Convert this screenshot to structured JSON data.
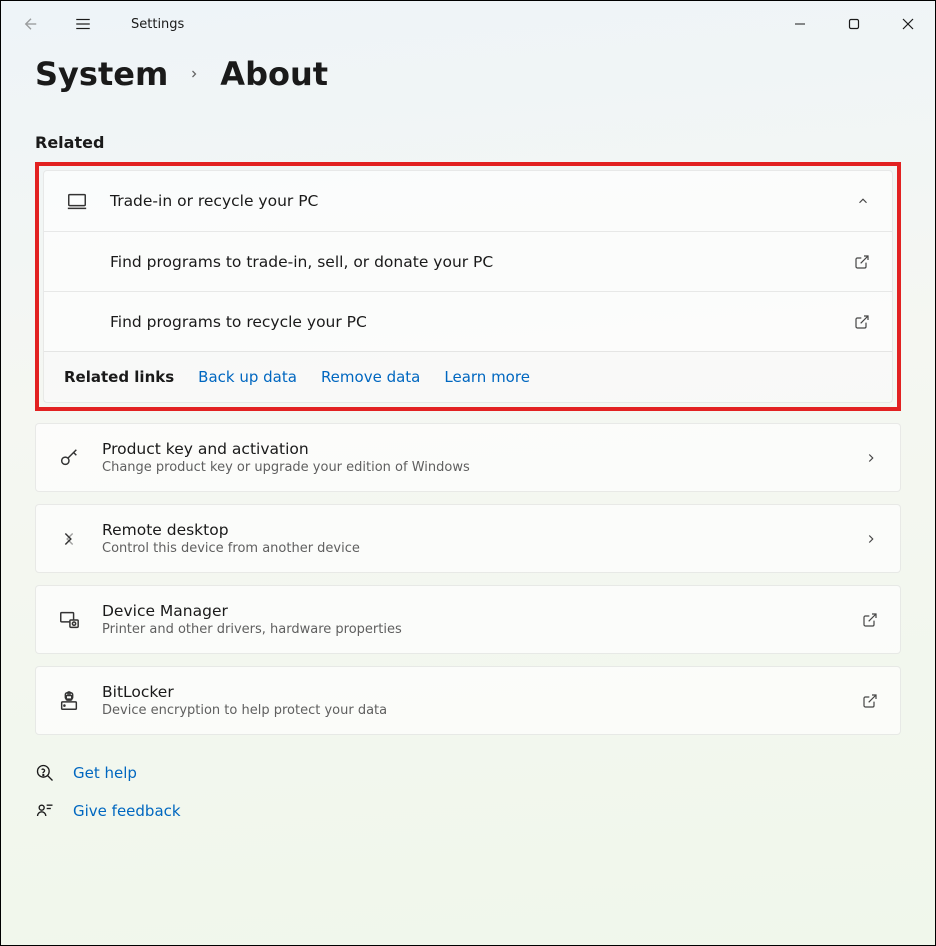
{
  "app_title": "Settings",
  "breadcrumb": {
    "parent": "System",
    "current": "About"
  },
  "section_heading": "Related",
  "trade_in": {
    "title": "Trade-in or recycle your PC",
    "sub1": "Find programs to trade-in, sell, or donate your PC",
    "sub2": "Find programs to recycle your PC"
  },
  "related_links": {
    "label": "Related links",
    "backup": "Back up data",
    "remove": "Remove data",
    "learn": "Learn more"
  },
  "product_key": {
    "title": "Product key and activation",
    "desc": "Change product key or upgrade your edition of Windows"
  },
  "remote_desktop": {
    "title": "Remote desktop",
    "desc": "Control this device from another device"
  },
  "device_manager": {
    "title": "Device Manager",
    "desc": "Printer and other drivers, hardware properties"
  },
  "bitlocker": {
    "title": "BitLocker",
    "desc": "Device encryption to help protect your data"
  },
  "help": {
    "get_help": "Get help",
    "give_feedback": "Give feedback"
  }
}
